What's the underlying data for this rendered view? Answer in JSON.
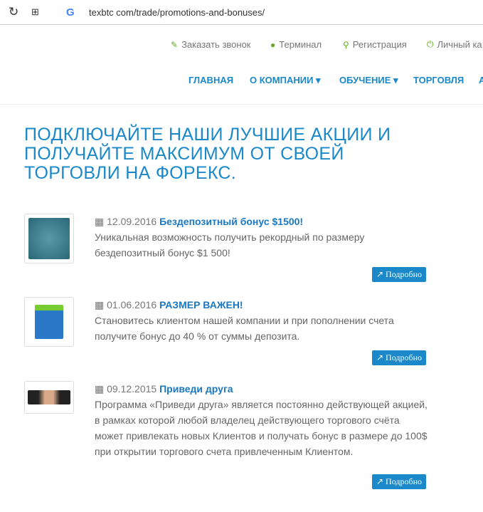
{
  "browser": {
    "url": "texbtc com/trade/promotions-and-bonuses/"
  },
  "topbar": [
    {
      "label": "Заказать звонок",
      "icon": "phone-icon"
    },
    {
      "label": "Терминал",
      "icon": "globe-icon"
    },
    {
      "label": "Регистрация",
      "icon": "key-icon"
    },
    {
      "label": "Личный ка",
      "icon": "power-icon"
    }
  ],
  "nav": [
    "ГЛАВНАЯ",
    "О КОМПАНИИ ▾",
    "ОБУЧЕНИЕ ▾",
    "ТОРГОВЛЯ",
    "А"
  ],
  "heading": "ПОДКЛЮЧАЙТЕ НАШИ ЛУЧШИЕ АКЦИИ И ПОЛУЧАЙТЕ МАКСИМУМ ОТ СВОЕЙ ТОРГОВЛИ НА ФОРЕКС.",
  "promos": [
    {
      "date": "12.09.2016",
      "title": "Бездепозитный бонус $1500!",
      "text": "Уникальная возможность получить рекордный по размеру бездепозитный бонус $1 500!",
      "button": "Подробно"
    },
    {
      "date": "01.06.2016",
      "title": "РАЗМЕР ВАЖЕН!",
      "text": "Становитесь клиентом нашей компании и при пополнении счета получите бонус до 40 % от суммы депозита.",
      "button": "Подробно"
    },
    {
      "date": "09.12.2015",
      "title": "Приведи друга",
      "text": "Программа «Приведи друга» является постоянно действующей акцией, в рамках которой любой владелец действующего торгового счёта может привлекать новых Клиентов и получать бонус в размере до 100$ при открытии торгового счета привлеченным Клиентом.",
      "button": "Подробно"
    }
  ]
}
